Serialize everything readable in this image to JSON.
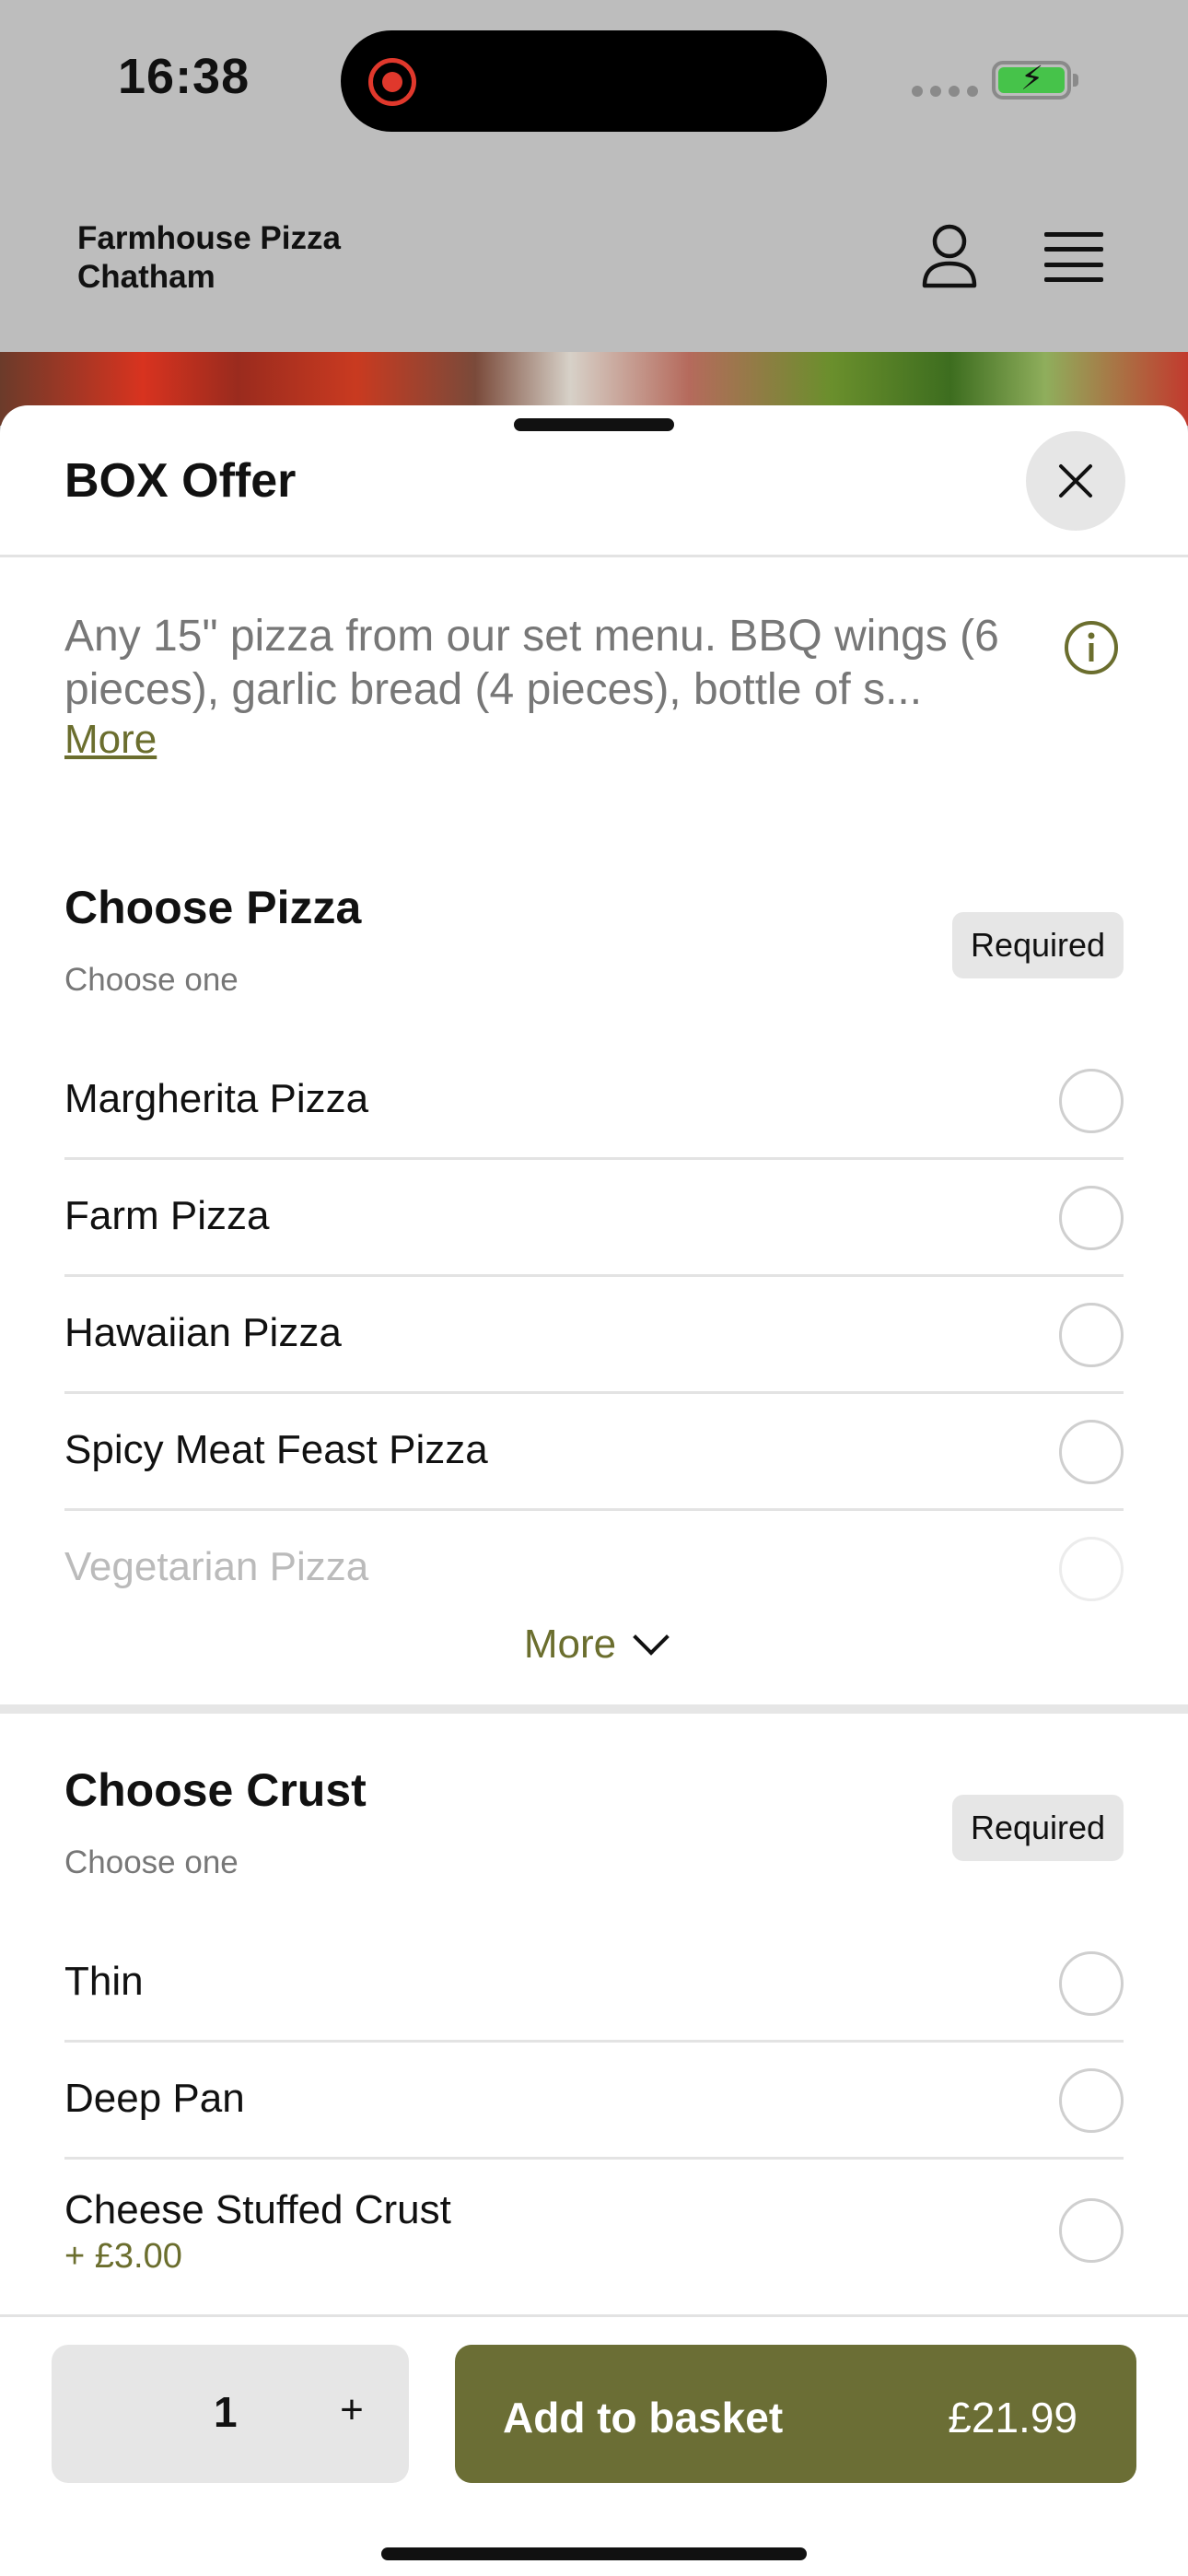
{
  "status_bar": {
    "time": "16:38"
  },
  "header": {
    "brand_line1": "Farmhouse Pizza",
    "brand_line2": "Chatham",
    "icons": [
      "user-icon",
      "menu-icon"
    ]
  },
  "sheet": {
    "title": "BOX Offer",
    "description": "Any 15\" pizza from our set menu. BBQ wings (6 pieces), garlic bread (4 pieces), bottle of s...",
    "description_more": "More",
    "groups": [
      {
        "title": "Choose Pizza",
        "subtitle": "Choose one",
        "badge": "Required",
        "options": [
          {
            "label": "Margherita Pizza"
          },
          {
            "label": "Farm Pizza"
          },
          {
            "label": "Hawaiian Pizza"
          },
          {
            "label": "Spicy Meat Feast Pizza"
          },
          {
            "label": "Vegetarian Pizza"
          }
        ],
        "more_label": "More"
      },
      {
        "title": "Choose Crust",
        "subtitle": "Choose one",
        "badge": "Required",
        "options": [
          {
            "label": "Thin"
          },
          {
            "label": "Deep Pan"
          },
          {
            "label": "Cheese Stuffed Crust",
            "price": "+ £3.00"
          }
        ]
      }
    ]
  },
  "footer": {
    "quantity": "1",
    "plus": "+",
    "add_label": "Add to basket",
    "price": "£21.99"
  },
  "colors": {
    "accent": "#6b6e35",
    "header_bg": "#bdbdbd"
  }
}
